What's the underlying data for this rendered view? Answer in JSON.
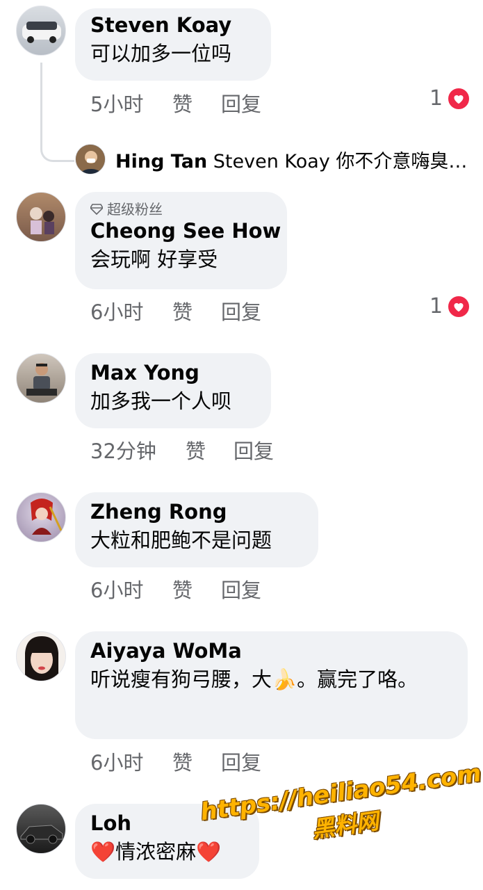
{
  "comments": [
    {
      "name": "Steven Koay",
      "text": "可以加多一位吗",
      "time": "5小时",
      "like": "赞",
      "reply": "回复",
      "reaction_count": "1"
    },
    {
      "badge": "超级粉丝",
      "name": "Cheong See How",
      "text": "会玩啊 好享受",
      "time": "6小时",
      "like": "赞",
      "reply": "回复",
      "reaction_count": "1"
    },
    {
      "name": "Max Yong",
      "text": "加多我一个人呗",
      "time": "32分钟",
      "like": "赞",
      "reply": "回复"
    },
    {
      "name": "Zheng Rong",
      "text": "大粒和肥鲍不是问题",
      "time": "6小时",
      "like": "赞",
      "reply": "回复"
    },
    {
      "name": "Aiyaya WoMa",
      "text": "听说瘦有狗弓腰，大🍌。赢完了咯。",
      "time": "6小时",
      "like": "赞",
      "reply": "回复"
    },
    {
      "name": "Loh",
      "text": "❤️情浓密麻❤️"
    }
  ],
  "reply_preview": {
    "name": "Hing Tan",
    "text": "Steven Koay 你不介意嗨臭…"
  },
  "watermark": {
    "url": "https://heiliao54.com",
    "cn": "黑料网"
  },
  "colors": {
    "bubble": "#f0f2f5",
    "meta": "#65676b",
    "heart": "#f02849",
    "watermark": "#ffb300"
  }
}
